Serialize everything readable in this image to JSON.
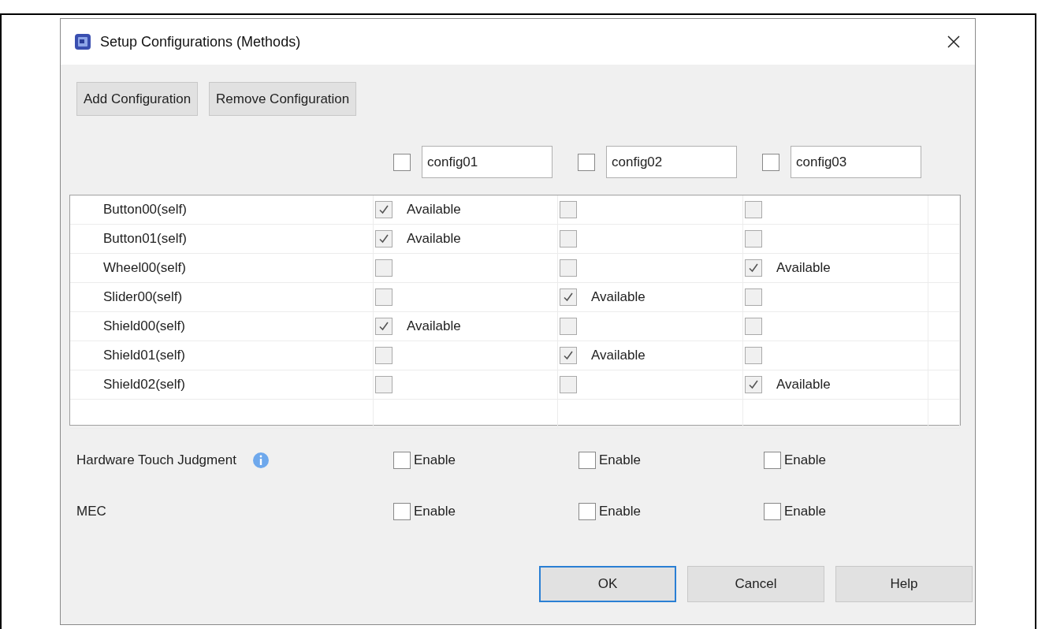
{
  "window": {
    "title": "Setup Configurations (Methods)"
  },
  "toolbar": [
    "Add Configuration",
    "Remove Configuration"
  ],
  "configurations": [
    {
      "name": "config01",
      "checked": false
    },
    {
      "name": "config02",
      "checked": false
    },
    {
      "name": "config03",
      "checked": false
    }
  ],
  "methods": [
    {
      "name": "Button00(self)",
      "cells": [
        {
          "checked": true,
          "label": "Available"
        },
        {
          "checked": false
        },
        {
          "checked": false
        }
      ]
    },
    {
      "name": "Button01(self)",
      "cells": [
        {
          "checked": true,
          "label": "Available"
        },
        {
          "checked": false
        },
        {
          "checked": false
        }
      ]
    },
    {
      "name": "Wheel00(self)",
      "cells": [
        {
          "checked": false
        },
        {
          "checked": false
        },
        {
          "checked": true,
          "label": "Available"
        }
      ]
    },
    {
      "name": "Slider00(self)",
      "cells": [
        {
          "checked": false
        },
        {
          "checked": true,
          "label": "Available"
        },
        {
          "checked": false
        }
      ]
    },
    {
      "name": "Shield00(self)",
      "cells": [
        {
          "checked": true,
          "label": "Available"
        },
        {
          "checked": false
        },
        {
          "checked": false
        }
      ]
    },
    {
      "name": "Shield01(self)",
      "cells": [
        {
          "checked": false
        },
        {
          "checked": true,
          "label": "Available"
        },
        {
          "checked": false
        }
      ]
    },
    {
      "name": "Shield02(self)",
      "cells": [
        {
          "checked": false
        },
        {
          "checked": false
        },
        {
          "checked": true,
          "label": "Available"
        }
      ]
    }
  ],
  "options": [
    {
      "label": "Hardware Touch Judgment",
      "info": true,
      "enables": [
        {
          "label": "Enable",
          "checked": false
        },
        {
          "label": "Enable",
          "checked": false
        },
        {
          "label": "Enable",
          "checked": false
        }
      ]
    },
    {
      "label": "MEC",
      "info": false,
      "enables": [
        {
          "label": "Enable",
          "checked": false
        },
        {
          "label": "Enable",
          "checked": false
        },
        {
          "label": "Enable",
          "checked": false
        }
      ]
    }
  ],
  "buttons": [
    {
      "label": "OK",
      "focused": true
    },
    {
      "label": "Cancel",
      "focused": false
    },
    {
      "label": "Help",
      "focused": false
    }
  ]
}
